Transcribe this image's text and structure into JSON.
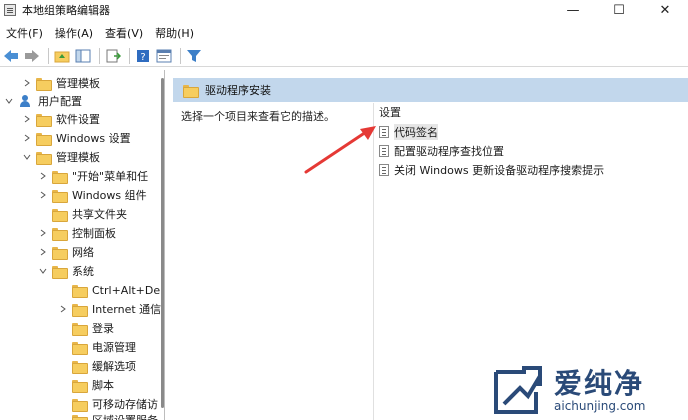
{
  "window": {
    "title": "本地组策略编辑器",
    "controls": {
      "minimize": "—",
      "maximize": "☐",
      "close": "✕"
    }
  },
  "menu": [
    {
      "label": "文件(F)"
    },
    {
      "label": "操作(A)"
    },
    {
      "label": "查看(V)"
    },
    {
      "label": "帮助(H)"
    }
  ],
  "toolbar": {
    "icons": [
      "back-arrow-icon",
      "forward-arrow-icon",
      "up-folder-icon",
      "show-hide-tree-icon",
      "export-list-icon",
      "help-icon",
      "properties-icon",
      "filter-icon"
    ]
  },
  "tree": {
    "items": [
      {
        "label": "管理模板"
      },
      {
        "label": "用户配置"
      },
      {
        "label": "软件设置"
      },
      {
        "label": "Windows 设置"
      },
      {
        "label": "管理模板"
      },
      {
        "label": "\"开始\"菜单和任"
      },
      {
        "label": "Windows 组件"
      },
      {
        "label": "共享文件夹"
      },
      {
        "label": "控制面板"
      },
      {
        "label": "网络"
      },
      {
        "label": "系统"
      },
      {
        "label": "Ctrl+Alt+De"
      },
      {
        "label": "Internet 通信"
      },
      {
        "label": "登录"
      },
      {
        "label": "电源管理"
      },
      {
        "label": "缓解选项"
      },
      {
        "label": "脚本"
      },
      {
        "label": "可移动存储访"
      },
      {
        "label": "区域设置服务"
      }
    ]
  },
  "content": {
    "section_title": "驱动程序安装",
    "description": "选择一个项目来查看它的描述。",
    "column_header": "设置",
    "settings": [
      {
        "label": "代码签名"
      },
      {
        "label": "配置驱动程序查找位置"
      },
      {
        "label": "关闭 Windows 更新设备驱动程序搜索提示"
      }
    ]
  },
  "watermark": {
    "brand_cn": "爱纯净",
    "brand_en": "aichunjing.com"
  },
  "colors": {
    "header_band": "#c2d7ec",
    "folder": "#f6cd5f",
    "arrow": "#e53935",
    "watermark": "#2a4a78"
  }
}
